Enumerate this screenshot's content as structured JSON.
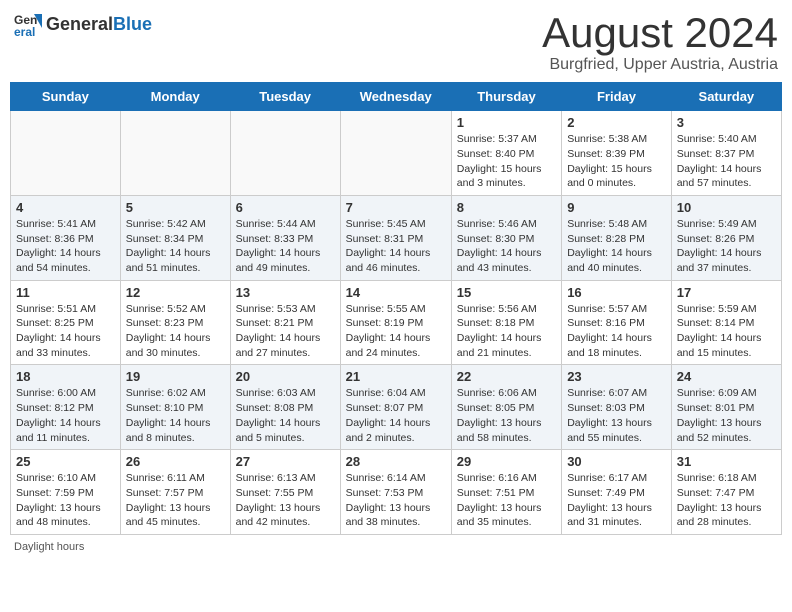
{
  "header": {
    "logo_general": "General",
    "logo_blue": "Blue",
    "title": "August 2024",
    "subtitle": "Burgfried, Upper Austria, Austria"
  },
  "weekdays": [
    "Sunday",
    "Monday",
    "Tuesday",
    "Wednesday",
    "Thursday",
    "Friday",
    "Saturday"
  ],
  "weeks": [
    [
      {
        "day": "",
        "info": ""
      },
      {
        "day": "",
        "info": ""
      },
      {
        "day": "",
        "info": ""
      },
      {
        "day": "",
        "info": ""
      },
      {
        "day": "1",
        "info": "Sunrise: 5:37 AM\nSunset: 8:40 PM\nDaylight: 15 hours and 3 minutes."
      },
      {
        "day": "2",
        "info": "Sunrise: 5:38 AM\nSunset: 8:39 PM\nDaylight: 15 hours and 0 minutes."
      },
      {
        "day": "3",
        "info": "Sunrise: 5:40 AM\nSunset: 8:37 PM\nDaylight: 14 hours and 57 minutes."
      }
    ],
    [
      {
        "day": "4",
        "info": "Sunrise: 5:41 AM\nSunset: 8:36 PM\nDaylight: 14 hours and 54 minutes."
      },
      {
        "day": "5",
        "info": "Sunrise: 5:42 AM\nSunset: 8:34 PM\nDaylight: 14 hours and 51 minutes."
      },
      {
        "day": "6",
        "info": "Sunrise: 5:44 AM\nSunset: 8:33 PM\nDaylight: 14 hours and 49 minutes."
      },
      {
        "day": "7",
        "info": "Sunrise: 5:45 AM\nSunset: 8:31 PM\nDaylight: 14 hours and 46 minutes."
      },
      {
        "day": "8",
        "info": "Sunrise: 5:46 AM\nSunset: 8:30 PM\nDaylight: 14 hours and 43 minutes."
      },
      {
        "day": "9",
        "info": "Sunrise: 5:48 AM\nSunset: 8:28 PM\nDaylight: 14 hours and 40 minutes."
      },
      {
        "day": "10",
        "info": "Sunrise: 5:49 AM\nSunset: 8:26 PM\nDaylight: 14 hours and 37 minutes."
      }
    ],
    [
      {
        "day": "11",
        "info": "Sunrise: 5:51 AM\nSunset: 8:25 PM\nDaylight: 14 hours and 33 minutes."
      },
      {
        "day": "12",
        "info": "Sunrise: 5:52 AM\nSunset: 8:23 PM\nDaylight: 14 hours and 30 minutes."
      },
      {
        "day": "13",
        "info": "Sunrise: 5:53 AM\nSunset: 8:21 PM\nDaylight: 14 hours and 27 minutes."
      },
      {
        "day": "14",
        "info": "Sunrise: 5:55 AM\nSunset: 8:19 PM\nDaylight: 14 hours and 24 minutes."
      },
      {
        "day": "15",
        "info": "Sunrise: 5:56 AM\nSunset: 8:18 PM\nDaylight: 14 hours and 21 minutes."
      },
      {
        "day": "16",
        "info": "Sunrise: 5:57 AM\nSunset: 8:16 PM\nDaylight: 14 hours and 18 minutes."
      },
      {
        "day": "17",
        "info": "Sunrise: 5:59 AM\nSunset: 8:14 PM\nDaylight: 14 hours and 15 minutes."
      }
    ],
    [
      {
        "day": "18",
        "info": "Sunrise: 6:00 AM\nSunset: 8:12 PM\nDaylight: 14 hours and 11 minutes."
      },
      {
        "day": "19",
        "info": "Sunrise: 6:02 AM\nSunset: 8:10 PM\nDaylight: 14 hours and 8 minutes."
      },
      {
        "day": "20",
        "info": "Sunrise: 6:03 AM\nSunset: 8:08 PM\nDaylight: 14 hours and 5 minutes."
      },
      {
        "day": "21",
        "info": "Sunrise: 6:04 AM\nSunset: 8:07 PM\nDaylight: 14 hours and 2 minutes."
      },
      {
        "day": "22",
        "info": "Sunrise: 6:06 AM\nSunset: 8:05 PM\nDaylight: 13 hours and 58 minutes."
      },
      {
        "day": "23",
        "info": "Sunrise: 6:07 AM\nSunset: 8:03 PM\nDaylight: 13 hours and 55 minutes."
      },
      {
        "day": "24",
        "info": "Sunrise: 6:09 AM\nSunset: 8:01 PM\nDaylight: 13 hours and 52 minutes."
      }
    ],
    [
      {
        "day": "25",
        "info": "Sunrise: 6:10 AM\nSunset: 7:59 PM\nDaylight: 13 hours and 48 minutes."
      },
      {
        "day": "26",
        "info": "Sunrise: 6:11 AM\nSunset: 7:57 PM\nDaylight: 13 hours and 45 minutes."
      },
      {
        "day": "27",
        "info": "Sunrise: 6:13 AM\nSunset: 7:55 PM\nDaylight: 13 hours and 42 minutes."
      },
      {
        "day": "28",
        "info": "Sunrise: 6:14 AM\nSunset: 7:53 PM\nDaylight: 13 hours and 38 minutes."
      },
      {
        "day": "29",
        "info": "Sunrise: 6:16 AM\nSunset: 7:51 PM\nDaylight: 13 hours and 35 minutes."
      },
      {
        "day": "30",
        "info": "Sunrise: 6:17 AM\nSunset: 7:49 PM\nDaylight: 13 hours and 31 minutes."
      },
      {
        "day": "31",
        "info": "Sunrise: 6:18 AM\nSunset: 7:47 PM\nDaylight: 13 hours and 28 minutes."
      }
    ]
  ],
  "footer": "Daylight hours"
}
